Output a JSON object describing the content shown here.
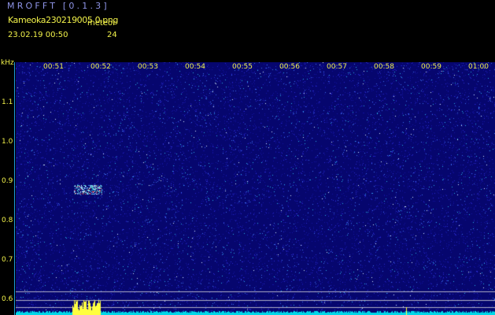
{
  "header": {
    "app_title": "MROFFT [0.1.3]",
    "filename": "Kameoka230219005 0.png",
    "meteor_label": "meteor",
    "datetime": "23.02.19 00:50",
    "meteor_count": "24"
  },
  "axes": {
    "y_unit": "kHz",
    "y_labels": [
      "1.1",
      "1.0",
      "0.9",
      "0.8",
      "0.7",
      "0.6"
    ],
    "x_labels": [
      "00:51",
      "00:52",
      "00:53",
      "00:54",
      "00:55",
      "00:56",
      "00:57",
      "00:58",
      "00:59",
      "01:00"
    ]
  },
  "colors": {
    "background": "#000000",
    "noise_base": "#06066e",
    "text_yellow": "#f2f24a",
    "title_blue": "#8e94e6",
    "baseline_cyan": "#00d8e8",
    "axis_blue": "#1e9cd8"
  }
}
